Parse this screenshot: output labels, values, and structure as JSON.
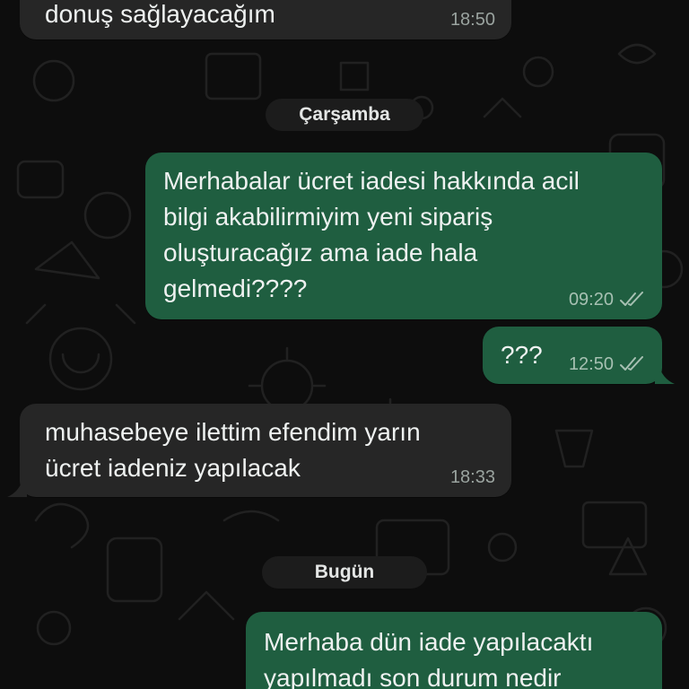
{
  "colors": {
    "background": "#0d0d0d",
    "incoming_bubble": "#262626",
    "outgoing_bubble": "#1f5e40",
    "text": "#eef1f0",
    "meta_text": "#9aa39f",
    "date_chip": "#1c1c1c"
  },
  "date_separators": {
    "wednesday": "Çarşamba",
    "today": "Bugün"
  },
  "messages": [
    {
      "direction": "incoming",
      "text": "donuş sağlayacağım",
      "time": "18:50"
    },
    {
      "direction": "outgoing",
      "text": "Merhabalar ücret iadesi hakkında acil\nbilgi akabilirmiyim yeni sipariş\noluşturacağız ama iade hala\ngelmedi????",
      "time": "09:20",
      "status_icon": "double-check-icon"
    },
    {
      "direction": "outgoing",
      "text": "???",
      "time": "12:50",
      "status_icon": "double-check-icon"
    },
    {
      "direction": "incoming",
      "text": "muhasebeye ilettim efendim yarın\nücret iadeniz yapılacak",
      "time": "18:33"
    },
    {
      "direction": "outgoing",
      "text": "Merhaba dün iade yapılacaktı\nyapılmadı son durum nedir",
      "time": ""
    }
  ]
}
